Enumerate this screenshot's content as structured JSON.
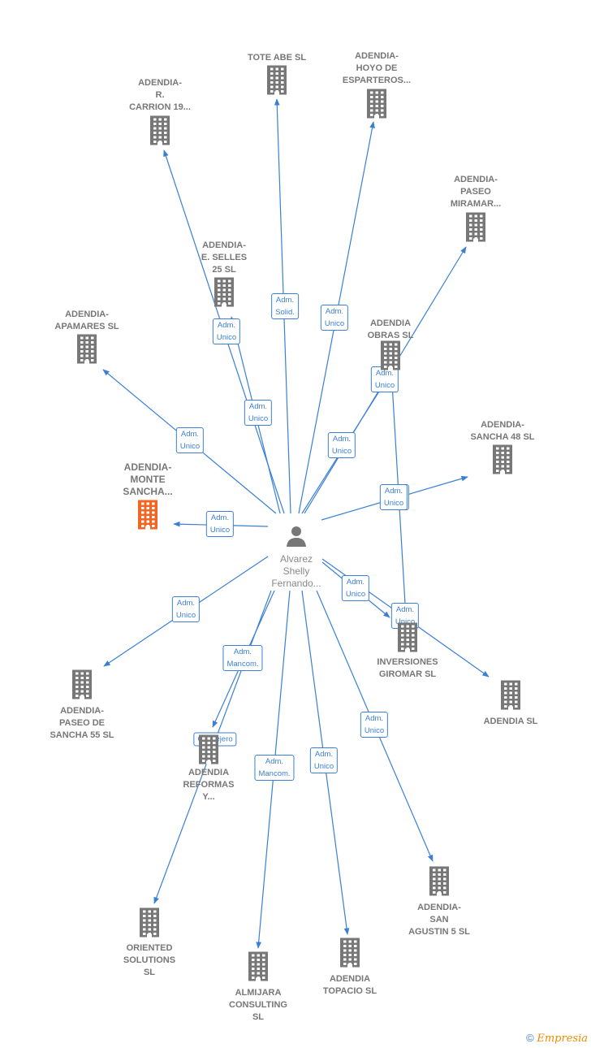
{
  "center": {
    "name": "Alvarez\nShelly\nFernando..."
  },
  "nodes": [
    {
      "name": "TOTE ABE SL"
    },
    {
      "name": "ADENDIA-\nHOYO DE\nESPARTEROS..."
    },
    {
      "name": "ADENDIA-\nR.\nCARRION 19..."
    },
    {
      "name": "ADENDIA-\nPASEO\nMIRAMAR..."
    },
    {
      "name": "ADENDIA-\nE.  SELLES\n25  SL"
    },
    {
      "name": "ADENDIA-\nAPAMARES  SL"
    },
    {
      "name": "ADENDIA\nOBRAS  SL"
    },
    {
      "name": "ADENDIA-\nSANCHA 48  SL"
    },
    {
      "name": "ADENDIA-\nMONTE\nSANCHA...",
      "focus": true
    },
    {
      "name": "INVERSIONES\nGIROMAR SL"
    },
    {
      "name": "ADENDIA SL"
    },
    {
      "name": "ADENDIA-\nPASEO DE\nSANCHA 55  SL"
    },
    {
      "name": "ADENDIA\nREFORMAS\nY..."
    },
    {
      "name": "ORIENTED\nSOLUTIONS\nSL"
    },
    {
      "name": "ALMIJARA\nCONSULTING\nSL"
    },
    {
      "name": "ADENDIA\nTOPACIO  SL"
    },
    {
      "name": "ADENDIA-\nSAN\nAGUSTIN 5  SL"
    }
  ],
  "edges": [
    {
      "label": "Adm.\nSolid."
    },
    {
      "label": "Adm.\nUnico"
    },
    {
      "label": "Adm.\nUnico"
    },
    {
      "label": "Adm.\nUnico"
    },
    {
      "label": "Adm.\nUnico"
    },
    {
      "label": "Adm.\nUnico"
    },
    {
      "label": "Adm.\nUnico"
    },
    {
      "label": "Adm.\nUnico"
    },
    {
      "label": "Adm.\nUnico"
    },
    {
      "label": "Adm.\nUnico"
    },
    {
      "label": "Adm.\nMancom."
    },
    {
      "label": "Consejero"
    },
    {
      "label": "Adm.\nMancom."
    },
    {
      "label": "Adm.\nUnico"
    },
    {
      "label": "Adm.\nUnico"
    },
    {
      "label": "Adm.\nUnico"
    },
    {
      "label": "Adm.\nUnico"
    },
    {
      "label": "Adm.\nUnico"
    }
  ],
  "colors": {
    "edge": "#3a7fd5",
    "building": "#777777",
    "focus": "#f26522"
  },
  "logo": {
    "symbol": "©",
    "text": "Empresia"
  }
}
